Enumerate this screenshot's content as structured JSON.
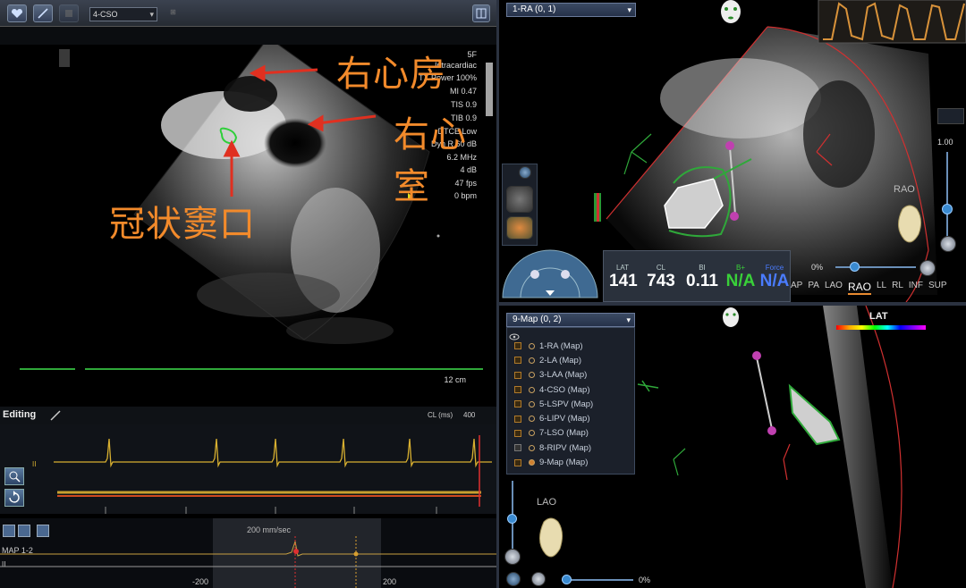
{
  "toolbar": {
    "mode_select": "4-CSO",
    "btn_small": "⊞"
  },
  "ultrasound": {
    "params": [
      "5F",
      "Intracardiac",
      "TX Power 100%",
      "MI 0.47",
      "TIS 0.9",
      "TIB 0.9",
      "DTCE Low",
      "Dyn R 60 dB",
      "6.2 MHz",
      "4 dB",
      "47 fps",
      "0 bpm"
    ],
    "depth": "12 cm",
    "annotations": {
      "ra": "右心房",
      "rv": "右心室",
      "cs_ostium": "冠状窦口"
    }
  },
  "editing": {
    "label": "Editing",
    "cl_label": "CL (ms)",
    "cl_value": "400"
  },
  "ecg": {
    "channel": "II"
  },
  "map_strip": {
    "speed": "200 mm/sec",
    "channel_label": "MAP 1-2",
    "channel_label2": "II",
    "tick_left": "-200",
    "tick_right": "200"
  },
  "view1": {
    "title": "1-RA (0, 1)",
    "stats": [
      {
        "label": "LAT",
        "value": "141",
        "color": "#ffffff"
      },
      {
        "label": "CL",
        "value": "743",
        "color": "#ffffff"
      },
      {
        "label": "BI",
        "value": "0.11",
        "color": "#ffffff"
      },
      {
        "label": "B+",
        "value": "N/A",
        "color": "#39d039"
      },
      {
        "label": "Force",
        "value": "N/A",
        "color": "#4a7cff"
      }
    ],
    "zoom": "1.00",
    "orient": "RAO",
    "percent": "0%",
    "views": [
      "AP",
      "PA",
      "LAO",
      "RAO",
      "LL",
      "RL",
      "INF",
      "SUP"
    ],
    "active_view": "RAO"
  },
  "view2": {
    "title": "9-Map (0, 2)",
    "maps": [
      "1-RA (Map)",
      "2-LA (Map)",
      "3-LAA (Map)",
      "4-CSO (Map)",
      "5-LSPV (Map)",
      "6-LIPV (Map)",
      "7-LSO (Map)",
      "8-RIPV (Map)",
      "9-Map (Map)"
    ],
    "orient": "LAO",
    "lat_label": "LAT",
    "percent": "0%"
  },
  "colors": {
    "accent": "#f28a2b",
    "trace_yellow": "#d8b030",
    "marker_red": "#e03030",
    "green": "#2fa83a"
  }
}
